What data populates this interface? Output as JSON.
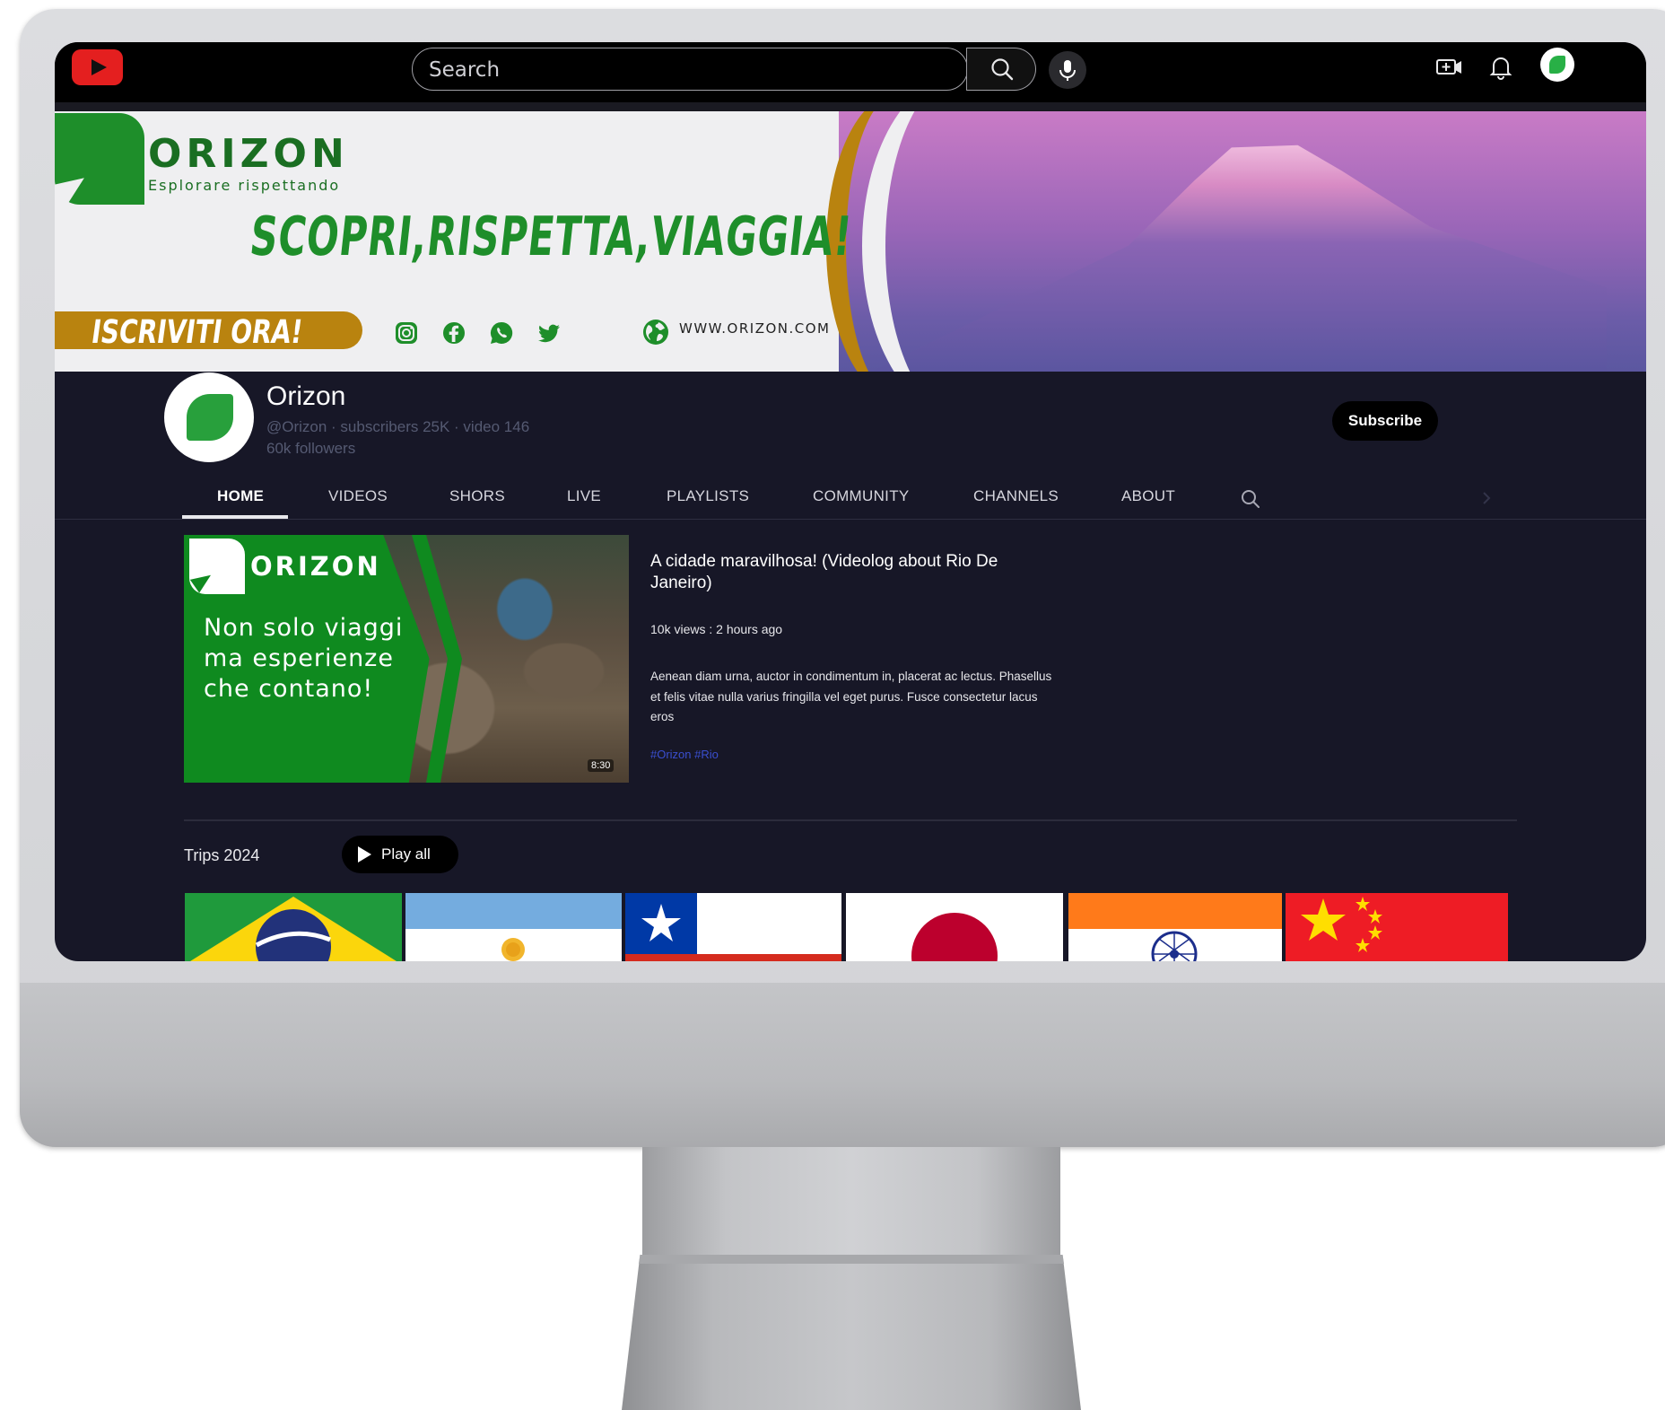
{
  "topbar": {
    "search_placeholder": "Search",
    "icons": [
      "youtube-logo-icon",
      "search-icon",
      "microphone-icon",
      "create-video-icon",
      "bell-icon",
      "avatar"
    ]
  },
  "banner": {
    "brand": "ORIZON",
    "tagline": "Esplorare rispettando",
    "slogan": "SCOPRI,RISPETTA,VIAGGIA!",
    "cta": "ISCRIVITI ORA!",
    "social_icons": [
      "instagram-icon",
      "facebook-icon",
      "whatsapp-icon",
      "twitter-icon"
    ],
    "website": "WWW.ORIZON.COM",
    "colors": {
      "green": "#1e8e2a",
      "gold": "#b9830f"
    }
  },
  "channel": {
    "name": "Orizon",
    "meta": "@Orizon · subscribers 25K · video 146",
    "followers": "60k followers",
    "subscribe_label": "Subscribe"
  },
  "tabs": [
    {
      "label": "HOME",
      "active": true
    },
    {
      "label": "VIDEOS",
      "active": false
    },
    {
      "label": "SHORS",
      "active": false
    },
    {
      "label": "LIVE",
      "active": false
    },
    {
      "label": "PLAYLISTS",
      "active": false
    },
    {
      "label": "COMMUNITY",
      "active": false
    },
    {
      "label": "CHANNELS",
      "active": false
    },
    {
      "label": "ABOUT",
      "active": false
    }
  ],
  "featured": {
    "thumb_brand": "ORIZON",
    "thumb_lines": [
      "Non solo viaggi",
      "ma esperienze",
      "che contano!"
    ],
    "duration": "8:30",
    "title": "A cidade maravilhosa!  (Videolog about Rio De Janeiro)",
    "meta": "10k views : 2 hours ago",
    "description": "Aenean diam urna, auctor in condimentum in, placerat ac lectus. Phasellus et felis vitae nulla varius fringilla vel eget purus. Fusce consectetur lacus eros",
    "tags": "#Orizon #Rio"
  },
  "playlist": {
    "title": "Trips 2024",
    "play_all_label": "Play all",
    "flags": [
      "brazil-flag",
      "argentina-flag",
      "chile-flag",
      "japan-flag",
      "india-flag",
      "china-flag"
    ]
  }
}
